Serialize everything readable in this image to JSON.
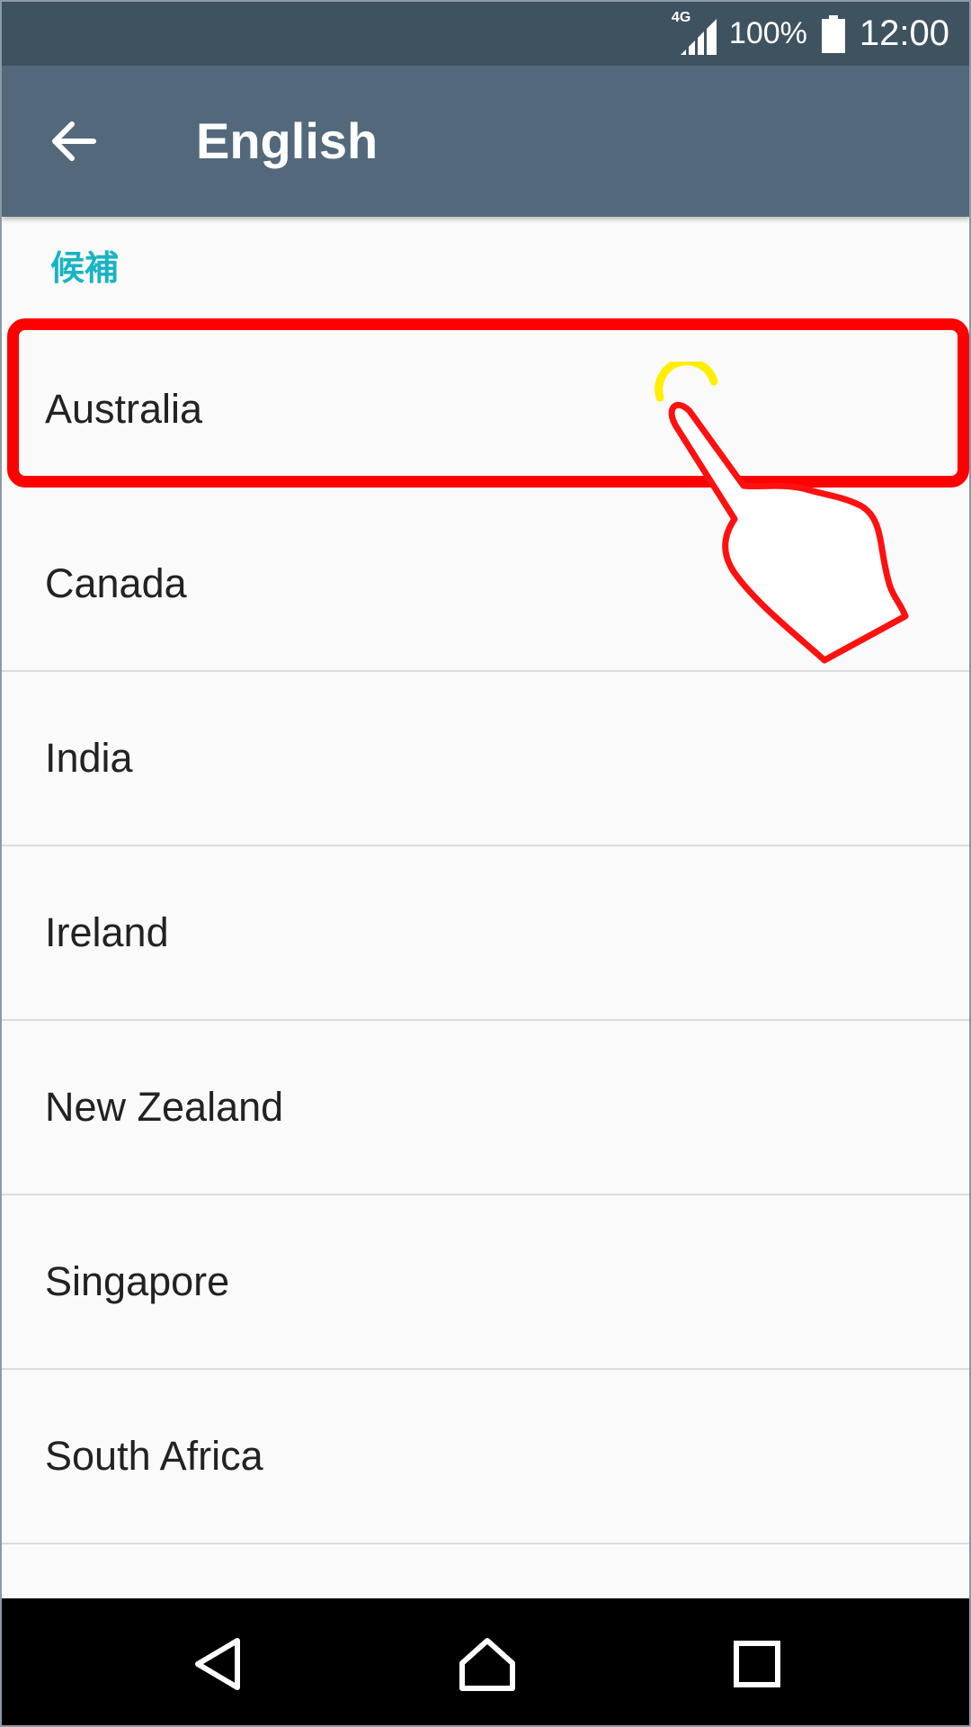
{
  "status_bar": {
    "network": "4G",
    "battery": "100%",
    "time": "12:00"
  },
  "app_bar": {
    "title": "English",
    "back_icon": "arrow-left-icon"
  },
  "section": {
    "header": "候補"
  },
  "list": {
    "items": [
      {
        "label": "Australia"
      },
      {
        "label": "Canada"
      },
      {
        "label": "India"
      },
      {
        "label": "Ireland"
      },
      {
        "label": "New Zealand"
      },
      {
        "label": "Singapore"
      },
      {
        "label": "South Africa"
      }
    ]
  },
  "nav_bar": {
    "back_icon": "triangle-back-icon",
    "home_icon": "home-icon",
    "recents_icon": "square-recents-icon"
  },
  "colors": {
    "status_bar": "#3f5260",
    "app_bar": "#53697b",
    "section_header": "#19b4c2",
    "highlight": "#ff0000"
  }
}
